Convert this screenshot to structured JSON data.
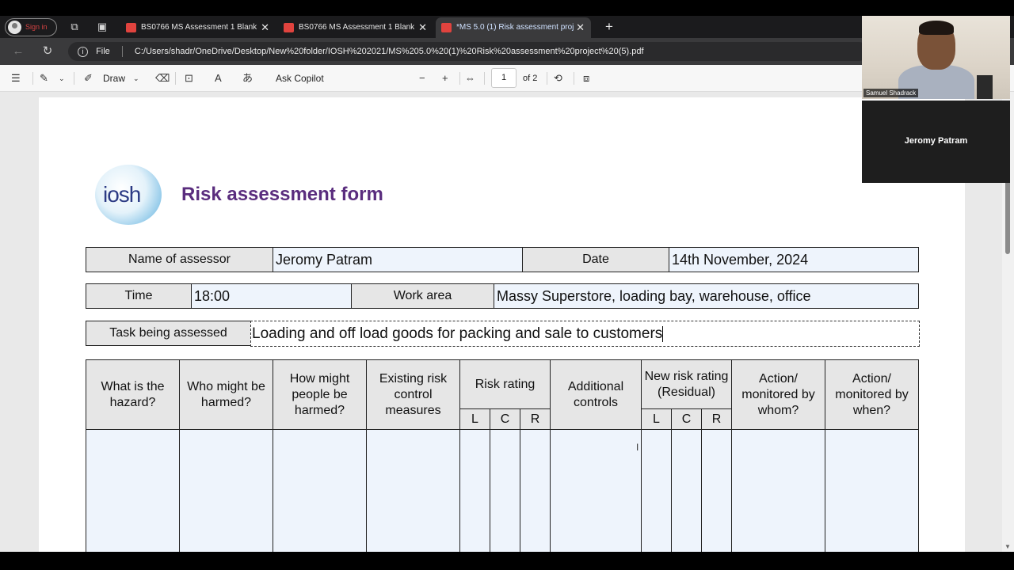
{
  "browser": {
    "sign_in": "Sign in",
    "tabs": [
      {
        "label": "BS0766 MS Assessment 1 Blank v",
        "active": false
      },
      {
        "label": "BS0766 MS Assessment 1 Blank v",
        "active": false
      },
      {
        "label": "*MS 5.0 (1) Risk assessment proje",
        "active": true
      }
    ],
    "address": {
      "protocol": "File",
      "url": "C:/Users/shadr/OneDrive/Desktop/New%20folder/IOSH%202021/MS%205.0%20(1)%20Risk%20assessment%20project%20(5).pdf"
    }
  },
  "pdf_toolbar": {
    "draw_label": "Draw",
    "ask_copilot": "Ask Copilot",
    "current_page": "1",
    "page_total": "of 2"
  },
  "document": {
    "logo_text": "iosh",
    "title": "Risk assessment form",
    "fields": {
      "assessor_label": "Name of assessor",
      "assessor_value": "Jeromy Patram",
      "date_label": "Date",
      "date_value": "14th November, 2024",
      "time_label": "Time",
      "time_value": "18:00",
      "work_area_label": "Work area",
      "work_area_value": "Massy Superstore, loading bay, warehouse, office",
      "task_label": "Task being assessed",
      "task_value": "Loading and off load goods for packing and sale to customers"
    },
    "table": {
      "headers": {
        "hazard": "What is the hazard?",
        "who": "Who might be harmed?",
        "how": "How might people be harmed?",
        "existing": "Existing risk control measures",
        "risk_rating": "Risk rating",
        "additional": "Additional controls",
        "new_risk": "New risk rating (Residual)",
        "action_whom": "Action/ monitored by whom?",
        "action_when": "Action/ monitored by when?"
      },
      "sub_headers": {
        "l": "L",
        "c": "C",
        "r": "R"
      }
    }
  },
  "video": {
    "participant_1": "Samuel Shadrack",
    "participant_2": "Jeromy Patram"
  }
}
